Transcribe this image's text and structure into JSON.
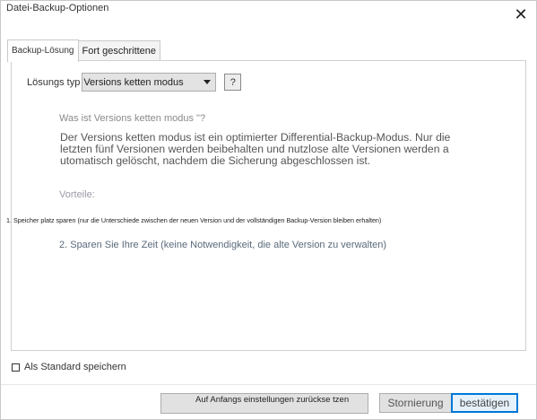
{
  "window": {
    "title": "Datei-Backup-Optionen",
    "close_symbol": "✕"
  },
  "tabs": [
    {
      "label": "Backup-Lösung",
      "active": true
    },
    {
      "label": "Fort geschrittene",
      "active": false
    }
  ],
  "backup_solution": {
    "type_label": "Lösungs typ",
    "type_selected": "Versions ketten modus",
    "help_label": "?",
    "question": "Was ist Versions ketten modus \"?",
    "description": "Der Versions ketten modus ist ein optimierter Differential-Backup-Modus. Nur die letzten fünf Versionen werden beibehalten und nutzlose alte Versionen werden a utomatisch gelöscht, nachdem die Sicherung abgeschlossen ist.",
    "advantages_heading": "Vorteile:",
    "advantage_1": "1. Speicher platz sparen (nur die Unterschiede zwischen der neuen Version und der vollständigen Backup-Version bleiben erhalten)",
    "advantage_2": "2. Sparen Sie Ihre Zeit (keine Notwendigkeit, die alte Version zu verwalten)"
  },
  "footer": {
    "save_default_label": "Als Standard speichern",
    "save_default_checked": false,
    "reset_button": "Auf Anfangs einstellungen zurückse tzen",
    "cancel_button": "Stornierung",
    "confirm_button": "bestätigen"
  },
  "colors": {
    "accent": "#0078d7",
    "button_bg": "#e1e1e1",
    "select_bg": "#e3e3e3"
  },
  "icons": {
    "close": "close-icon",
    "dropdown": "chevron-down-icon",
    "help": "question-mark-icon",
    "checkbox": "checkbox-icon"
  }
}
